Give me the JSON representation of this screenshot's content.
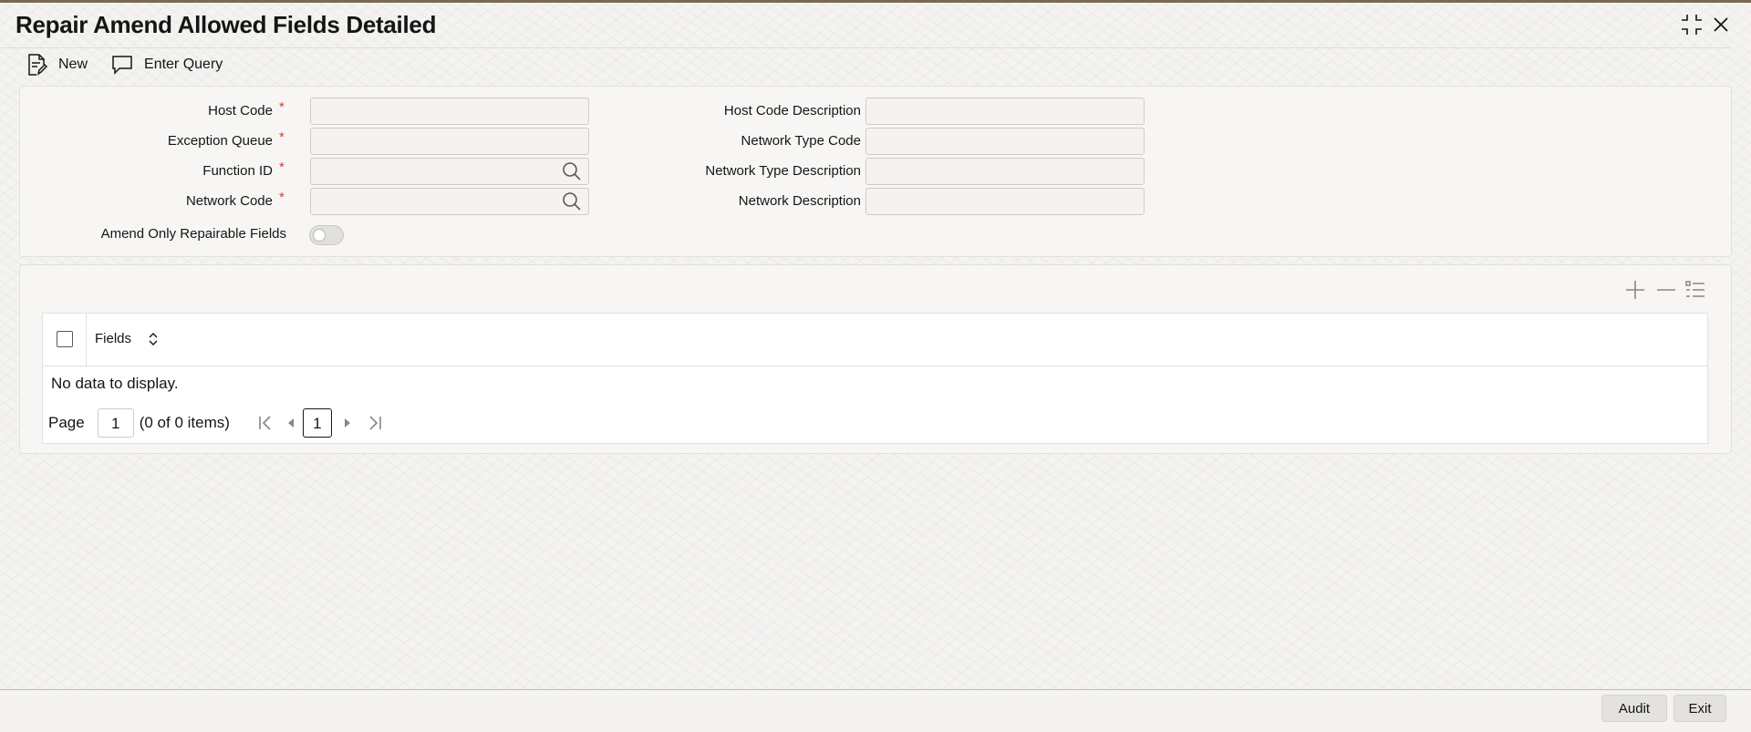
{
  "window": {
    "title": "Repair Amend Allowed Fields Detailed",
    "controls": [
      "collapse-icon",
      "close-icon"
    ]
  },
  "toolbar": {
    "new_label": "New",
    "enter_query_label": "Enter Query"
  },
  "form": {
    "host_code": {
      "label": "Host Code",
      "required": "*",
      "value": ""
    },
    "exception_queue": {
      "label": "Exception Queue",
      "required": "*",
      "value": ""
    },
    "function_id": {
      "label": "Function ID",
      "required": "*",
      "value": ""
    },
    "network_code": {
      "label": "Network Code",
      "required": "*",
      "value": ""
    },
    "amend_only_repairable": {
      "label": "Amend Only Repairable Fields",
      "checked": false
    },
    "host_code_description": {
      "label": "Host Code Description",
      "value": ""
    },
    "network_type_code": {
      "label": "Network Type Code",
      "value": ""
    },
    "network_type_description": {
      "label": "Network Type Description",
      "value": ""
    },
    "network_description": {
      "label": "Network Description",
      "value": ""
    }
  },
  "grid": {
    "tools": [
      "add-icon",
      "remove-icon",
      "column-list-icon"
    ],
    "columns": [
      {
        "label": "Fields"
      }
    ],
    "rows": [],
    "empty_text": "No data to display.",
    "pager": {
      "page_label": "Page",
      "page_value": "1",
      "summary": "(0 of 0 items)",
      "current": "1"
    }
  },
  "footer": {
    "audit_label": "Audit",
    "exit_label": "Exit"
  },
  "colors": {
    "required": "#c74634",
    "title": "#161513",
    "background": "#f4f3f1"
  }
}
